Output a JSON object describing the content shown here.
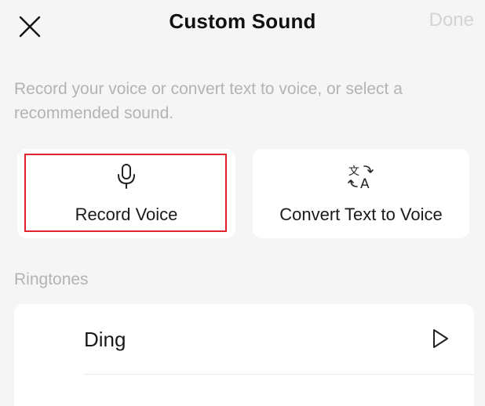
{
  "header": {
    "title": "Custom Sound",
    "done_label": "Done",
    "close_icon": "close-icon"
  },
  "description": "Record your voice or convert text to voice, or select a recommended sound.",
  "options": [
    {
      "label": "Record Voice",
      "icon": "microphone-icon",
      "highlighted": true
    },
    {
      "label": "Convert Text to Voice",
      "icon": "translate-icon",
      "highlighted": false
    }
  ],
  "ringtones": {
    "section_label": "Ringtones",
    "items": [
      {
        "name": "Ding",
        "icon": "play-icon"
      }
    ]
  },
  "colors": {
    "background": "#f5f5f5",
    "card": "#ffffff",
    "muted_text": "#b3b3b3",
    "disabled_text": "#d3d3d3",
    "highlight_border": "#e0242e"
  }
}
